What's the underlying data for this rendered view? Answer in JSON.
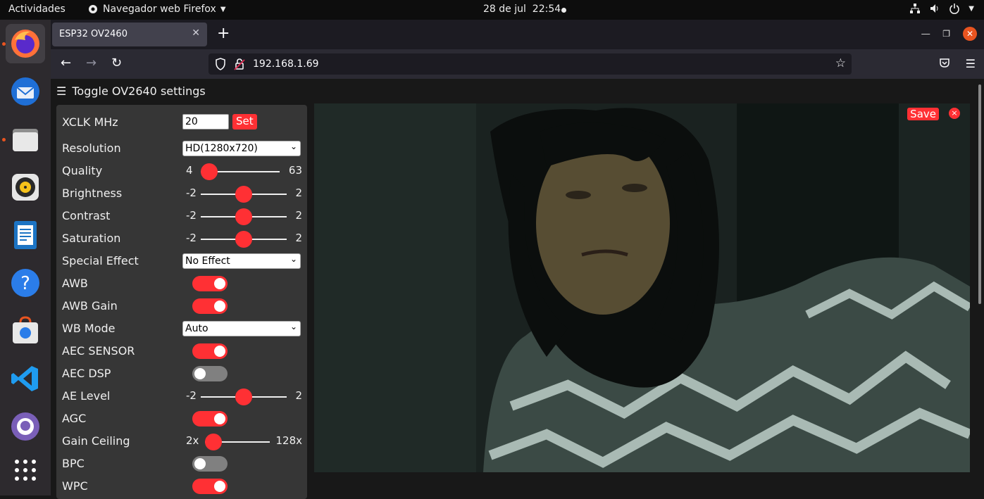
{
  "topbar": {
    "activities": "Actividades",
    "app_name": "Navegador web Firefox",
    "date": "28 de jul",
    "time": "22:54"
  },
  "dock": {
    "items": [
      "firefox-icon",
      "thunderbird-icon",
      "files-icon",
      "rhythmbox-icon",
      "writer-icon",
      "help-icon",
      "software-icon",
      "vscode-icon",
      "github-icon",
      "app-grid-icon"
    ]
  },
  "browser": {
    "tab_title": "ESP32 OV2460",
    "url": "192.168.1.69"
  },
  "page": {
    "toggle_label": "Toggle OV2640 settings",
    "xclk": {
      "label": "XCLK MHz",
      "value": "20",
      "button": "Set"
    },
    "resolution": {
      "label": "Resolution",
      "value": "HD(1280x720)"
    },
    "quality": {
      "label": "Quality",
      "min": "4",
      "max": "63",
      "value": 4
    },
    "brightness": {
      "label": "Brightness",
      "min": "-2",
      "max": "2",
      "value": 0
    },
    "contrast": {
      "label": "Contrast",
      "min": "-2",
      "max": "2",
      "value": 0
    },
    "saturation": {
      "label": "Saturation",
      "min": "-2",
      "max": "2",
      "value": 0
    },
    "special_effect": {
      "label": "Special Effect",
      "value": "No Effect"
    },
    "awb": {
      "label": "AWB",
      "on": true
    },
    "awb_gain": {
      "label": "AWB Gain",
      "on": true
    },
    "wb_mode": {
      "label": "WB Mode",
      "value": "Auto"
    },
    "aec_sensor": {
      "label": "AEC SENSOR",
      "on": true
    },
    "aec_dsp": {
      "label": "AEC DSP",
      "on": false
    },
    "ae_level": {
      "label": "AE Level",
      "min": "-2",
      "max": "2",
      "value": 0
    },
    "agc": {
      "label": "AGC",
      "on": true
    },
    "gain_ceiling": {
      "label": "Gain Ceiling",
      "min": "2x",
      "max": "128x",
      "value": 0
    },
    "bpc": {
      "label": "BPC",
      "on": false
    },
    "wpc": {
      "label": "WPC",
      "on": true
    },
    "save_label": "Save",
    "close_label": "×"
  },
  "colors": {
    "accent": "#ff3034",
    "ubuntu_orange": "#e95420"
  }
}
